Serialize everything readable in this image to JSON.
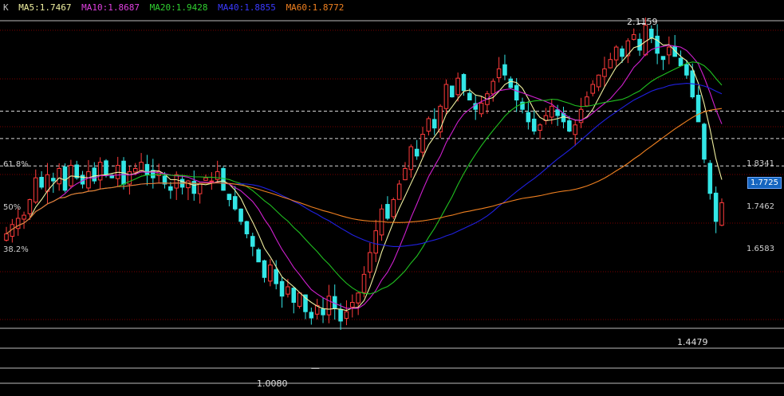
{
  "legend": {
    "prefix": "K",
    "ma5": "MA5:1.7467",
    "ma10": "MA10:1.8687",
    "ma20": "MA20:1.9428",
    "ma40": "MA40:1.8855",
    "ma60": "MA60:1.8772"
  },
  "colors": {
    "background": "#000000",
    "candle_up": "#ff3b3b",
    "candle_down": "#33e6e6",
    "ma5": "#f0f0a0",
    "ma10": "#d020d0",
    "ma20": "#20c020",
    "ma40": "#2020e0",
    "ma60": "#f08020",
    "grid_red": "#7a0000",
    "fib_line": "#d8d8d8",
    "price_tag": "#1565c0"
  },
  "fib_levels": [
    {
      "label": "61.8%",
      "value": "1.8341"
    },
    {
      "label": "50%",
      "value": "1.7462"
    },
    {
      "label": "38.2%",
      "value": "1.6583"
    }
  ],
  "current_price": "1.7725",
  "high_label": "2.1159",
  "low_label": "1.0080",
  "recent_low_label": "1.4479",
  "chart_data": {
    "type": "candlestick",
    "ylim": [
      0.95,
      2.14
    ],
    "grid": true,
    "series": [
      {
        "name": "MA5",
        "value": 1.7467
      },
      {
        "name": "MA10",
        "value": 1.8687
      },
      {
        "name": "MA20",
        "value": 1.9428
      },
      {
        "name": "MA40",
        "value": 1.8855
      },
      {
        "name": "MA60",
        "value": 1.8772
      }
    ],
    "fib_retracement": [
      {
        "level": "61.8%",
        "price": 1.8341
      },
      {
        "level": "50%",
        "price": 1.7462
      },
      {
        "level": "38.2%",
        "price": 1.6583
      }
    ],
    "annotations": {
      "high": 2.1159,
      "low": 1.008,
      "last_low": 1.4479,
      "last_price": 1.7725
    },
    "closes": [
      1.44,
      1.47,
      1.49,
      1.5,
      1.55,
      1.62,
      1.59,
      1.63,
      1.61,
      1.65,
      1.58,
      1.66,
      1.62,
      1.6,
      1.64,
      1.61,
      1.67,
      1.63,
      1.62,
      1.66,
      1.6,
      1.64,
      1.65,
      1.67,
      1.63,
      1.62,
      1.64,
      1.6,
      1.58,
      1.63,
      1.59,
      1.61,
      1.57,
      1.6,
      1.62,
      1.61,
      1.64,
      1.58,
      1.55,
      1.52,
      1.48,
      1.44,
      1.4,
      1.35,
      1.3,
      1.34,
      1.28,
      1.24,
      1.27,
      1.22,
      1.25,
      1.19,
      1.17,
      1.21,
      1.18,
      1.24,
      1.2,
      1.16,
      1.19,
      1.22,
      1.25,
      1.31,
      1.38,
      1.45,
      1.52,
      1.49,
      1.55,
      1.6,
      1.65,
      1.72,
      1.69,
      1.76,
      1.81,
      1.78,
      1.85,
      1.92,
      1.88,
      1.94,
      1.9,
      1.87,
      1.84,
      1.86,
      1.89,
      1.93,
      1.97,
      1.95,
      1.91,
      1.87,
      1.84,
      1.8,
      1.77,
      1.79,
      1.82,
      1.85,
      1.82,
      1.8,
      1.77,
      1.79,
      1.84,
      1.88,
      1.92,
      1.95,
      1.97,
      2.0,
      2.04,
      2.01,
      2.06,
      2.08,
      2.03,
      2.11,
      2.07,
      2.02,
      2.0,
      2.04,
      2.01,
      1.98,
      1.95,
      1.88,
      1.8,
      1.68,
      1.57,
      1.48,
      1.54
    ]
  }
}
